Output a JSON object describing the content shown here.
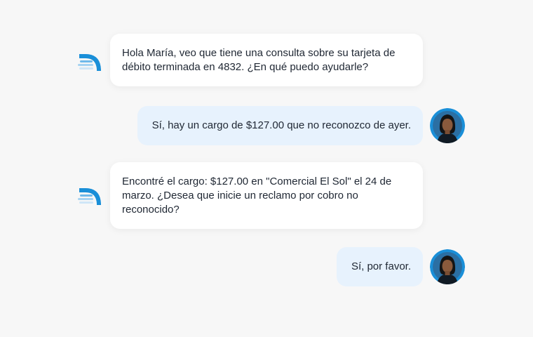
{
  "conversation": {
    "messages": [
      {
        "sender": "bot",
        "text": "Hola María, veo que tiene una consulta sobre su tarjeta de débito terminada en 4832. ¿En qué puedo ayudarle?"
      },
      {
        "sender": "user",
        "text": "Sí, hay un cargo de $127.00 que no reconozco de ayer."
      },
      {
        "sender": "bot",
        "text": "Encontré el cargo: $127.00 en \"Comercial El Sol\" el 24 de marzo. ¿Desea que inicie un reclamo por cobro no reconocido?"
      },
      {
        "sender": "user",
        "text": "Sí, por favor."
      }
    ]
  },
  "icons": {
    "bot": "bot-logo-icon",
    "user": "user-avatar"
  },
  "colors": {
    "background": "#f7f7f7",
    "bot_bubble": "#ffffff",
    "user_bubble": "#e7f2fd",
    "brand_blue": "#1a8fd8",
    "text": "#1f2733"
  }
}
